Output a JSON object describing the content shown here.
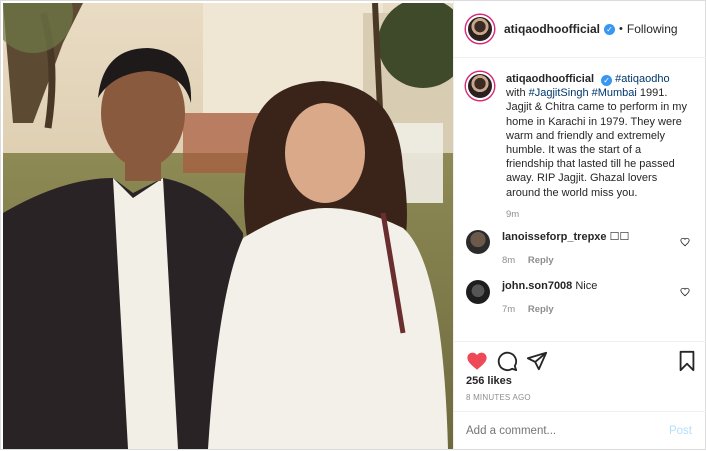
{
  "post": {
    "username": "atiqaodhoofficial",
    "follow_status": "Following",
    "separator": "•",
    "verified_mark": "✓"
  },
  "caption": {
    "username": "atiqaodhoofficial",
    "hashtag_1": "#atiqaodho",
    "text_1": " with ",
    "hashtag_2": "#JagjitSingh",
    "text_2": " ",
    "hashtag_3": "#Mumbai",
    "text_3": " 1991. Jagjit & Chitra came to perform in my home in Karachi in 1979. They were warm and friendly and extremely humble. It was the start of a friendship that lasted till he passed away. RIP Jagjit. Ghazal lovers around the world miss you.",
    "time": "9m"
  },
  "comments": [
    {
      "username": "lanoisseforp_trepxe",
      "text": "☐☐",
      "time": "8m",
      "reply": "Reply"
    },
    {
      "username": "john.son7008",
      "text": "Nice",
      "time": "7m",
      "reply": "Reply"
    }
  ],
  "actions": {
    "like_icon": "heart-filled-icon",
    "comment_icon": "comment-icon",
    "share_icon": "share-icon",
    "save_icon": "bookmark-icon"
  },
  "likes": "256 likes",
  "posted_ago": "8 MINUTES AGO",
  "add_comment": {
    "placeholder": "Add a comment...",
    "post_label": "Post"
  },
  "colors": {
    "like_red": "#ed4956",
    "link_blue": "#00376b",
    "verified_blue": "#3897f0",
    "muted_gray": "#8e8e8e",
    "post_disabled": "#b2dffc"
  }
}
